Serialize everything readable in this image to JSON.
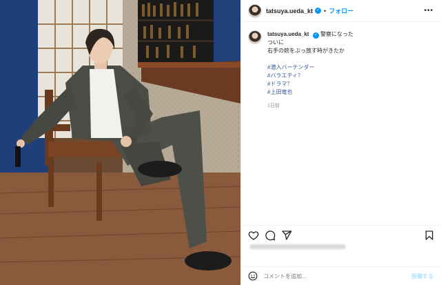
{
  "header": {
    "username": "tatsuya.ueda_kt",
    "separator": "•",
    "follow_label": "フォロー",
    "more_icon": "more-horizontal-icon"
  },
  "caption": {
    "username": "tatsuya.ueda_kt",
    "lines": [
      "警察になった",
      "ついに",
      "右手の銃をぶっ放す時がきたか"
    ],
    "hashtags": [
      "#潜入バーテンダー",
      "#バラエティ？",
      "#ドラマ？",
      "#上田竜也"
    ],
    "age": "1日前"
  },
  "actions": {
    "like_icon": "heart-icon",
    "comment_icon": "comment-icon",
    "share_icon": "send-icon",
    "save_icon": "bookmark-icon"
  },
  "comment": {
    "emoji_icon": "emoji-icon",
    "placeholder": "コメントを追加...",
    "post_label": "投稿する"
  },
  "colors": {
    "accent": "#0095f6",
    "hashtag": "#3b5998",
    "muted": "#8e8e8e",
    "border": "#efefef"
  }
}
